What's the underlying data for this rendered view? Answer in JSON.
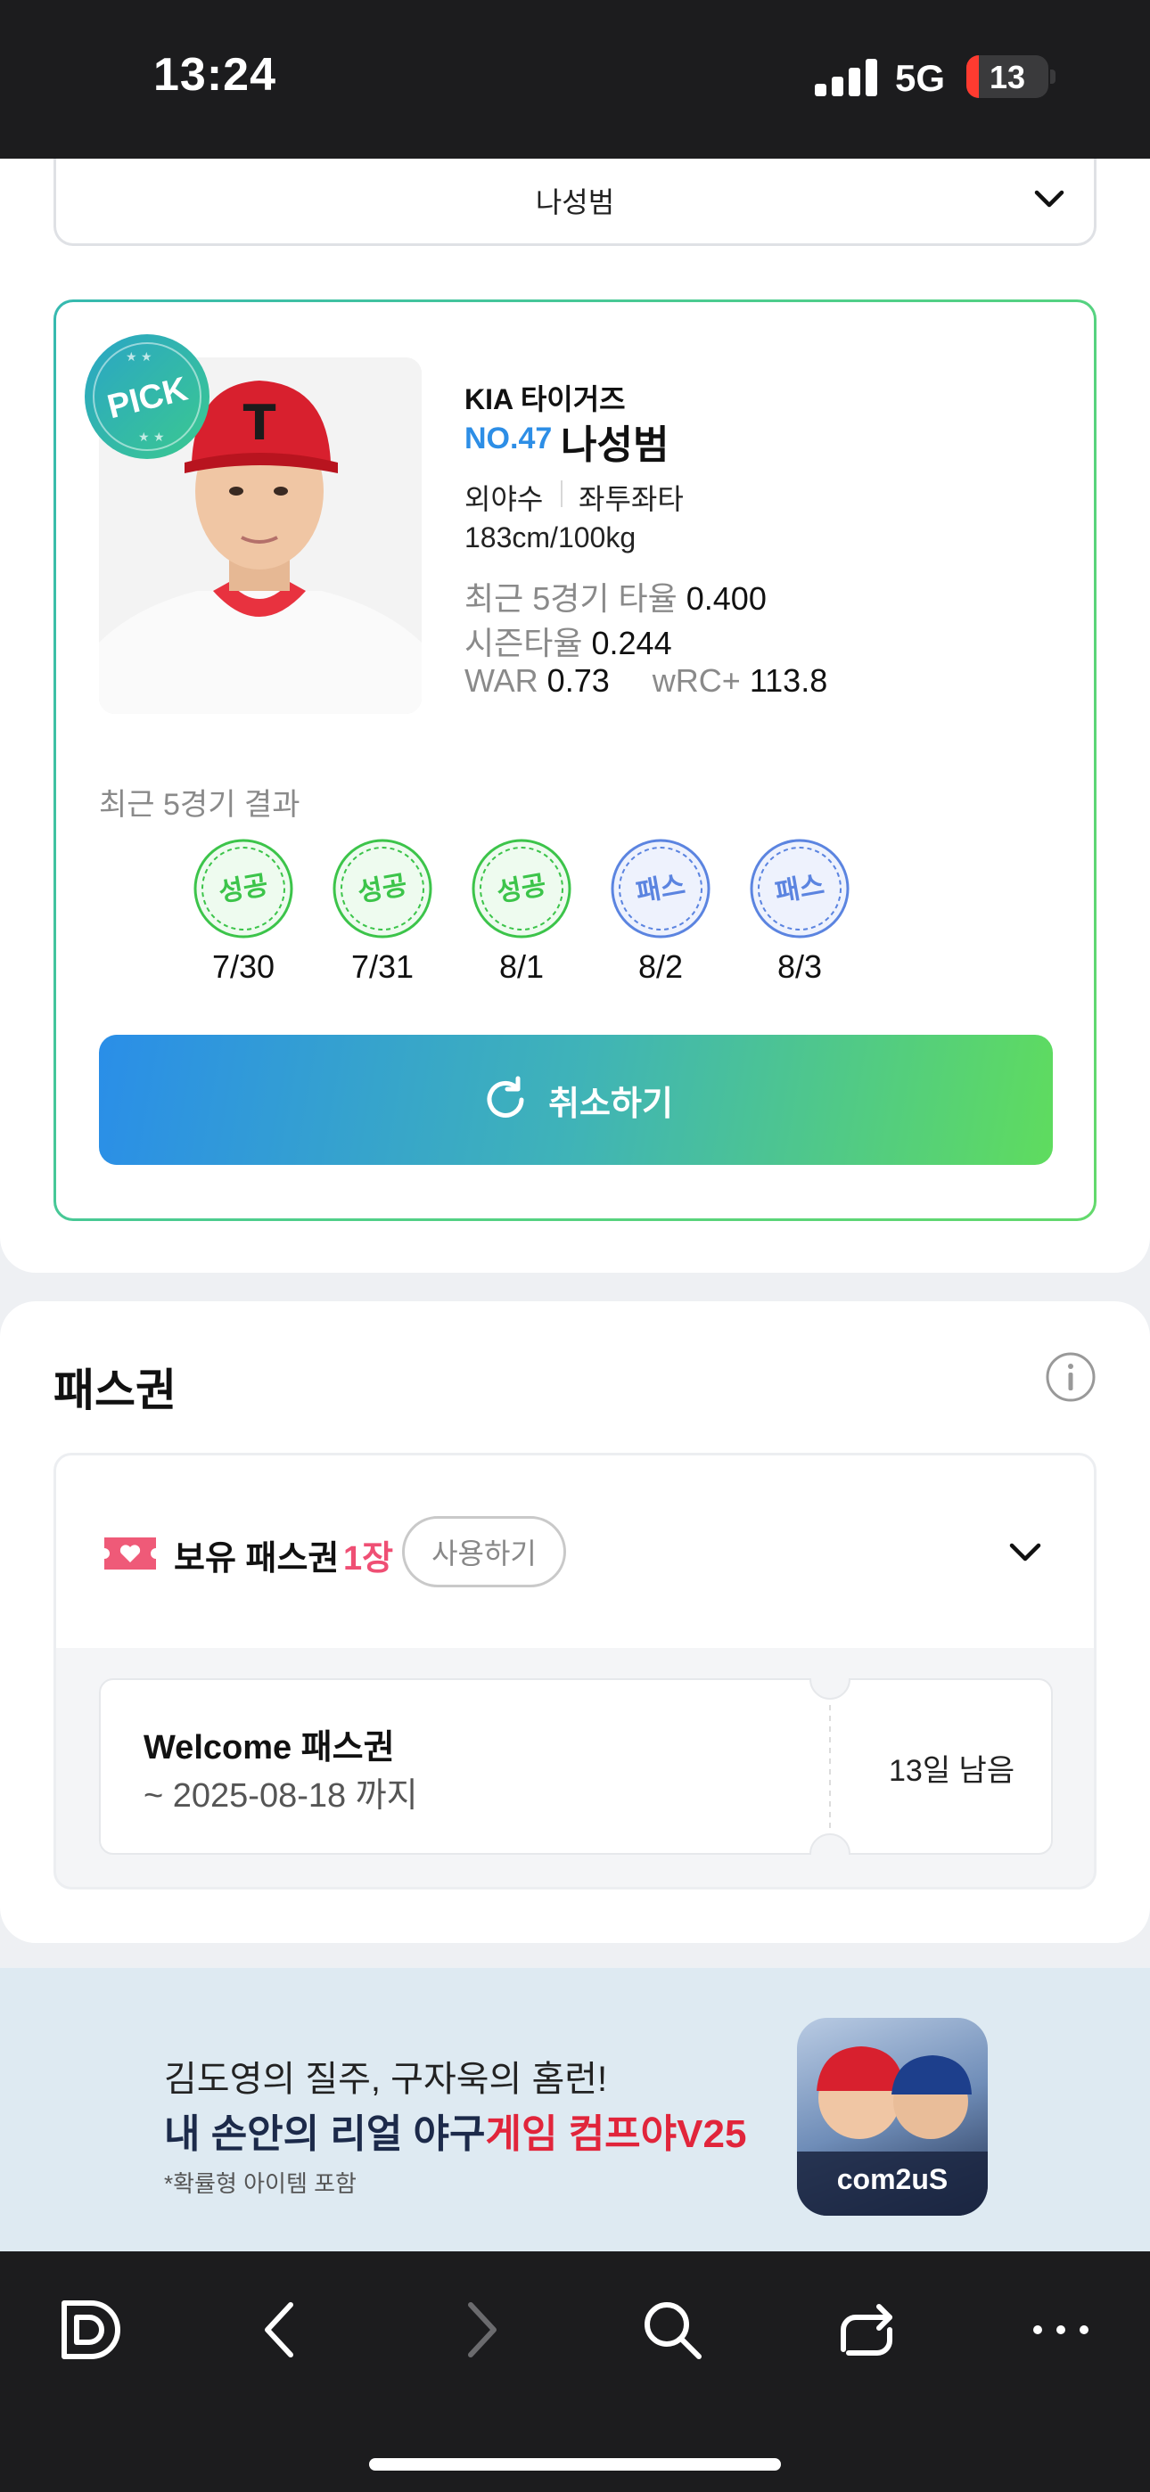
{
  "status_bar": {
    "time": "13:24",
    "network": "5G",
    "battery": "13"
  },
  "player_select": {
    "value": "나성범"
  },
  "player_card": {
    "badge": "PICK",
    "team": "KIA 타이거즈",
    "number": "NO.47",
    "name": "나성범",
    "position": "외야수",
    "bats": "좌투좌타",
    "size": "183cm/100kg",
    "stats": {
      "recent5_label": "최근 5경기 타율",
      "recent5_value": "0.400",
      "season_label": "시즌타율",
      "season_value": "0.244",
      "war_label": "WAR",
      "war_value": "0.73",
      "wrc_label": "wRC+",
      "wrc_value": "113.8"
    },
    "recent_results_title": "최근 5경기 결과",
    "recent_results": [
      {
        "result": "성공",
        "date": "7/30",
        "color": "#3cc44a"
      },
      {
        "result": "성공",
        "date": "7/31",
        "color": "#3cc44a"
      },
      {
        "result": "성공",
        "date": "8/1",
        "color": "#3cc44a"
      },
      {
        "result": "패스",
        "date": "8/2",
        "color": "#5b84e0"
      },
      {
        "result": "패스",
        "date": "8/3",
        "color": "#5b84e0"
      }
    ],
    "cancel_button": "취소하기"
  },
  "pass_section": {
    "title": "패스권",
    "owned_label": "보유 패스권",
    "owned_count": "1장",
    "use_button": "사용하기",
    "coupon": {
      "title": "Welcome 패스권",
      "expires": "~ 2025-08-18 까지",
      "remaining": "13일 남음"
    }
  },
  "ad_banner": {
    "line1": "김도영의 질주, 구자욱의 홈런!",
    "line2_prefix": "내 손안의 리얼 야구",
    "line2_highlight": "게임 컴프야V25",
    "note": "*확률형 아이템 포함",
    "brand": "com2uS"
  },
  "toolbar": {
    "icons": [
      "daum-icon",
      "back-icon",
      "forward-icon",
      "search-icon",
      "share-icon",
      "more-icon"
    ]
  },
  "colors": {
    "accent_blue": "#2d8ee6",
    "accent_green": "#5fdc5e",
    "pink": "#ef4f74"
  }
}
